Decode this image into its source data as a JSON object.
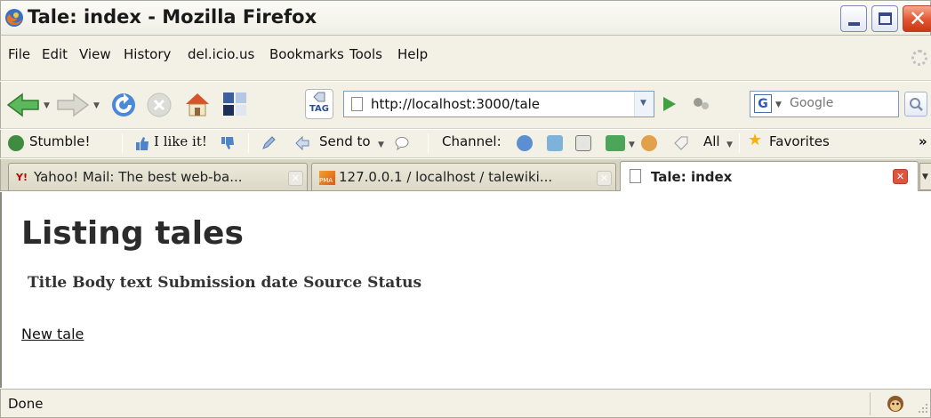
{
  "window": {
    "title": "Tale: index - Mozilla Firefox"
  },
  "menu": [
    "File",
    "Edit",
    "View",
    "History",
    "del.icio.us",
    "Bookmarks",
    "Tools",
    "Help"
  ],
  "navbar": {
    "url": "http://localhost:3000/tale",
    "search_engine_letter": "G",
    "search_placeholder": "Google",
    "tag_label": "TAG",
    "icons": [
      "back-arrow-icon",
      "forward-arrow-icon",
      "reload-icon",
      "stop-icon",
      "home-icon",
      "bookmark-manager-icon",
      "tag-icon",
      "go-icon",
      "plugin-icon",
      "search-magnifier-icon"
    ]
  },
  "stumblebar": {
    "stumble": "Stumble!",
    "ilike": "I like it!",
    "sendto": "Send to",
    "channel": "Channel:",
    "all": "All",
    "favorites": "Favorites",
    "overflow": "»"
  },
  "tabs": [
    {
      "label": "Yahoo! Mail: The best web-ba...",
      "active": false,
      "icon": "yahoo-icon"
    },
    {
      "label": "127.0.0.1 / localhost / talewiki...",
      "active": false,
      "icon": "phpmyadmin-icon"
    },
    {
      "label": "Tale: index",
      "active": true,
      "icon": "page-icon"
    }
  ],
  "page": {
    "heading": "Listing tales",
    "columns": [
      "Title",
      "Body text",
      "Submission date",
      "Source",
      "Status"
    ],
    "new_link": "New tale"
  },
  "status": {
    "text": "Done"
  },
  "colors": {
    "chrome": "#f3f1e6",
    "close_button": "#e2542f",
    "link": "#111111",
    "go_green": "#3fa13f"
  }
}
